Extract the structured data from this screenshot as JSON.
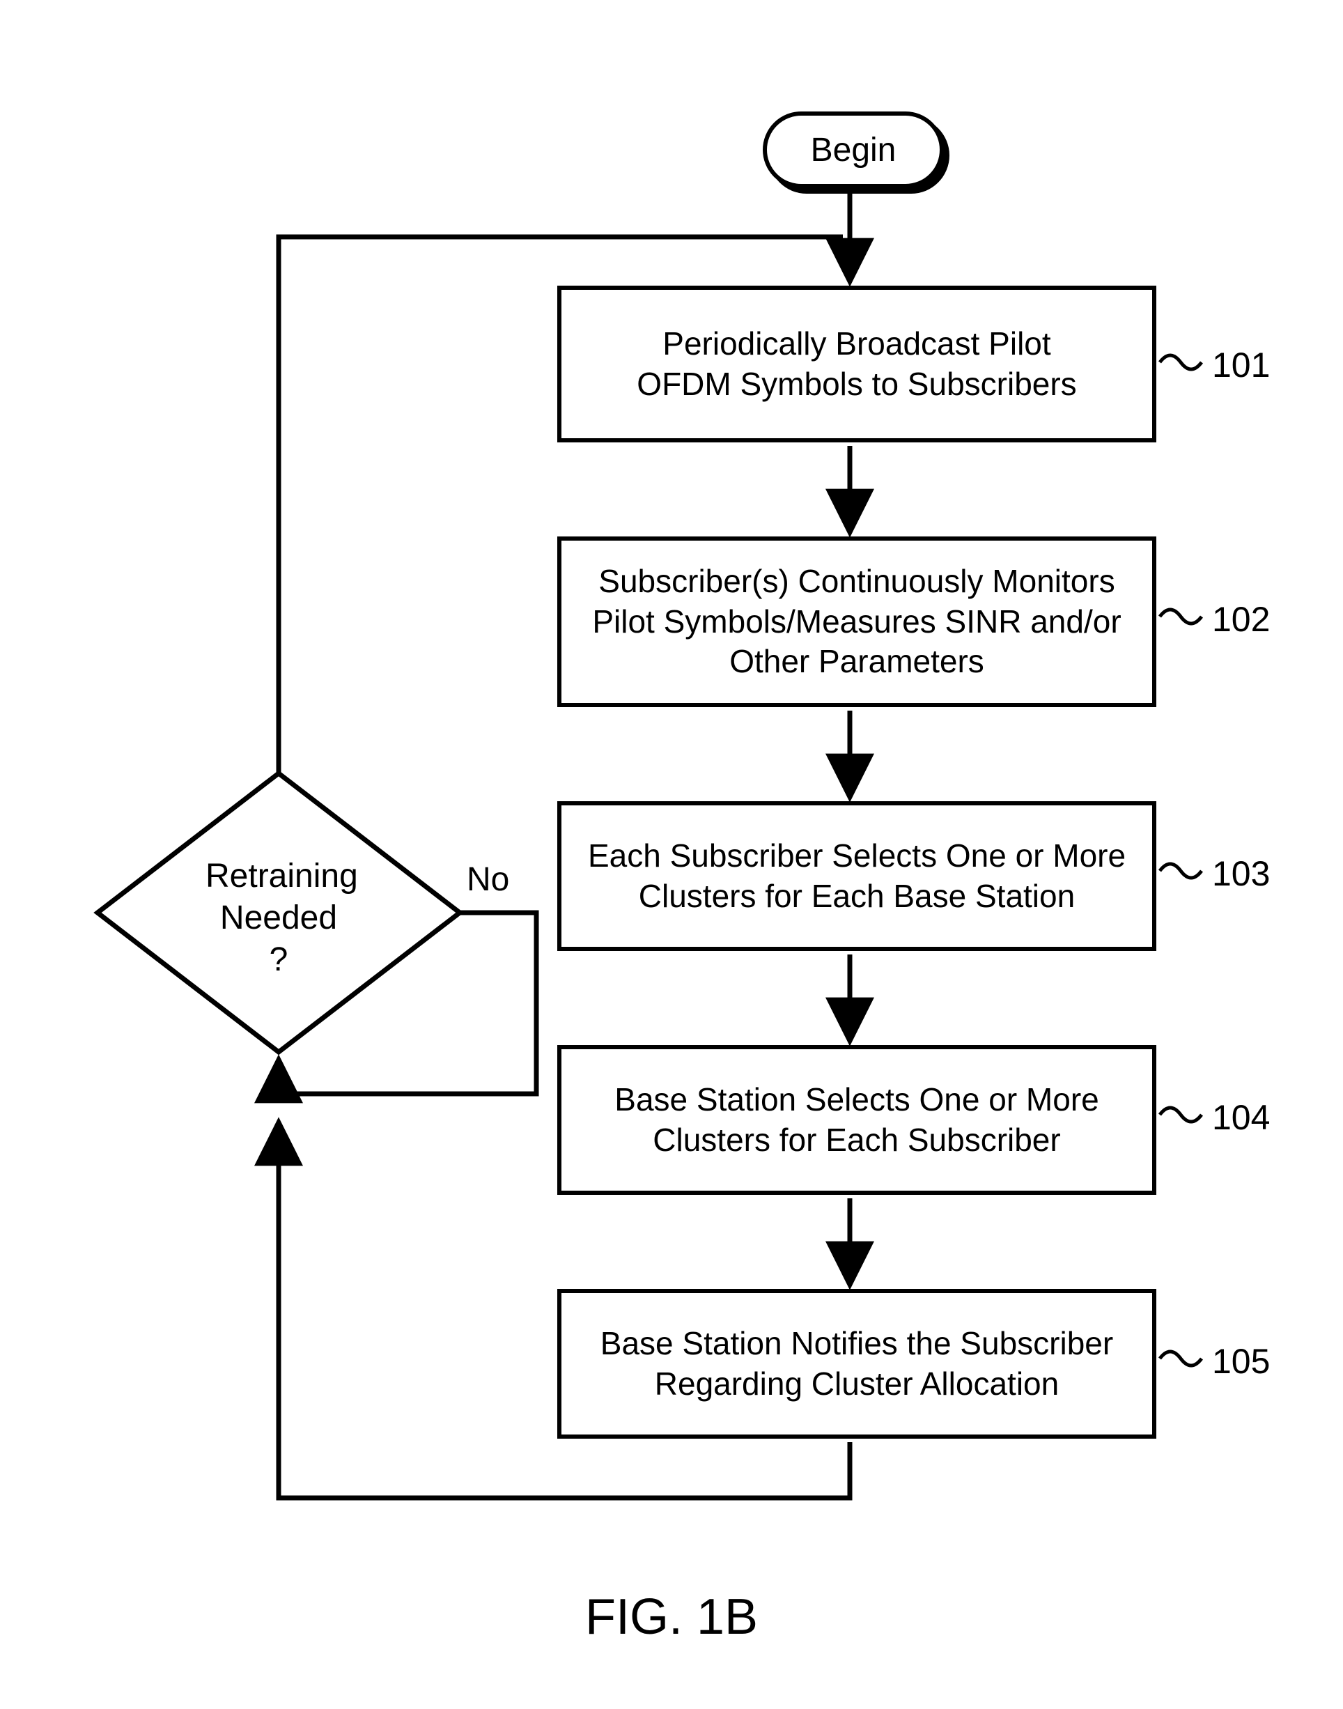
{
  "terminator": {
    "label": "Begin"
  },
  "steps": {
    "s101": {
      "text": "Periodically Broadcast Pilot\nOFDM Symbols to Subscribers",
      "ref": "101"
    },
    "s102": {
      "text": "Subscriber(s) Continuously Monitors\nPilot Symbols/Measures SINR and/or\nOther Parameters",
      "ref": "102"
    },
    "s103": {
      "text": "Each Subscriber Selects One or More\nClusters for Each Base Station",
      "ref": "103"
    },
    "s104": {
      "text": "Base Station Selects One or More\nClusters for Each Subscriber",
      "ref": "104"
    },
    "s105": {
      "text": "Base Station Notifies the Subscriber\nRegarding Cluster Allocation",
      "ref": "105"
    }
  },
  "decision": {
    "line1": "Retraining",
    "line2": "Needed",
    "line3": "?",
    "no": "No"
  },
  "caption": "FIG. 1B",
  "chart_data": {
    "type": "flowchart",
    "nodes": [
      {
        "id": "begin",
        "kind": "terminator",
        "label": "Begin"
      },
      {
        "id": "101",
        "kind": "process",
        "label": "Periodically Broadcast Pilot OFDM Symbols to Subscribers"
      },
      {
        "id": "102",
        "kind": "process",
        "label": "Subscriber(s) Continuously Monitors Pilot Symbols/Measures SINR and/or Other Parameters"
      },
      {
        "id": "103",
        "kind": "process",
        "label": "Each Subscriber Selects One or More Clusters for Each Base Station"
      },
      {
        "id": "104",
        "kind": "process",
        "label": "Base Station Selects One or More Clusters for Each Subscriber"
      },
      {
        "id": "105",
        "kind": "process",
        "label": "Base Station Notifies the Subscriber Regarding Cluster Allocation"
      },
      {
        "id": "retrain",
        "kind": "decision",
        "label": "Retraining Needed ?"
      }
    ],
    "edges": [
      {
        "from": "begin",
        "to": "101"
      },
      {
        "from": "101",
        "to": "102"
      },
      {
        "from": "102",
        "to": "103"
      },
      {
        "from": "103",
        "to": "104"
      },
      {
        "from": "104",
        "to": "105"
      },
      {
        "from": "105",
        "to": "retrain"
      },
      {
        "from": "retrain",
        "to": "101",
        "label": "No"
      }
    ]
  }
}
